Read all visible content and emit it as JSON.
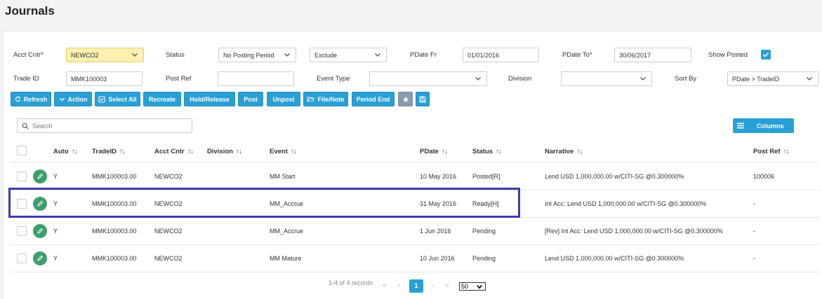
{
  "page": {
    "title": "Journals"
  },
  "filters": {
    "acct_cntr": {
      "label": "Acct Cntr*",
      "value": "NEWCO2"
    },
    "status": {
      "label": "Status",
      "value": "No Posting Period"
    },
    "exclude": {
      "value": "Exclude"
    },
    "pdate_fr": {
      "label": "PDate Fr",
      "value": "01/01/2016"
    },
    "pdate_to": {
      "label": "PDate To*",
      "value": "30/06/2017"
    },
    "show_posted": {
      "label": "Show Posted",
      "checked": true
    },
    "trade_id": {
      "label": "Trade ID",
      "value": "MMK100003"
    },
    "post_ref": {
      "label": "Post Ref",
      "value": ""
    },
    "event_type": {
      "label": "Event Type",
      "value": ""
    },
    "division": {
      "label": "Division",
      "value": ""
    },
    "sort_by": {
      "label": "Sort By",
      "value": "PDate > TradeID"
    }
  },
  "toolbar": {
    "refresh": "Refresh",
    "action": "Action",
    "select_all": "Select All",
    "recreate": "Recreate",
    "hold_release": "Hold/Release",
    "post": "Post",
    "unpost": "Unpost",
    "file_note": "File/Note",
    "period_end": "Period End"
  },
  "search": {
    "placeholder": "Search"
  },
  "columns_button": "Columns",
  "table": {
    "headers": {
      "auto": "Auto",
      "trade_id": "TradeID",
      "acct_cntr": "Acct Cntr",
      "division": "Division",
      "event": "Event",
      "pdate": "PDate",
      "status": "Status",
      "narrative": "Narrative",
      "post_ref": "Post Ref"
    },
    "rows": [
      {
        "auto": "Y",
        "trade_id": "MMK100003.00",
        "acct_cntr": "NEWCO2",
        "division": "",
        "event": "MM Start",
        "pdate": "10 May 2016",
        "status": "Posted[R]",
        "narrative": "Lend USD 1,000,000.00 w/CITI-SG @0.300000%",
        "post_ref": "100006"
      },
      {
        "auto": "Y",
        "trade_id": "MMK100003.00",
        "acct_cntr": "NEWCO2",
        "division": "",
        "event": "MM_Accrue",
        "pdate": "31 May 2016",
        "status": "Ready[H]",
        "narrative": "Int Acc: Lend USD 1,000,000.00 w/CITI-SG @0.300000%",
        "post_ref": "-"
      },
      {
        "auto": "Y",
        "trade_id": "MMK100003.00",
        "acct_cntr": "NEWCO2",
        "division": "",
        "event": "MM_Accrue",
        "pdate": "1 Jun 2016",
        "status": "Pending",
        "narrative": "[Rev] Int Acc: Lend USD 1,000,000.00 w/CITI-SG @0.300000%",
        "post_ref": "-"
      },
      {
        "auto": "Y",
        "trade_id": "MMK100003.00",
        "acct_cntr": "NEWCO2",
        "division": "",
        "event": "MM Mature",
        "pdate": "10 Jun 2016",
        "status": "Pending",
        "narrative": "Lend USD 1,000,000.00 w/CITI-SG @0.300000%",
        "post_ref": "-"
      }
    ]
  },
  "pagination": {
    "summary": "1-4 of 4 records",
    "current_page": "1",
    "page_size": "50"
  }
}
